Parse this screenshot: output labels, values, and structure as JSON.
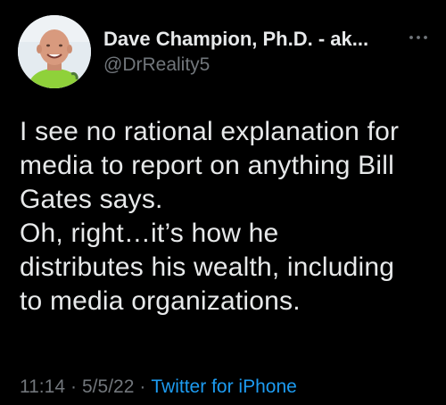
{
  "author": {
    "display_name": "Dave Champion, Ph.D. - ak...",
    "handle": "@DrReality5",
    "avatar_icon": "profile-photo"
  },
  "tweet": {
    "lines": [
      "I see no rational explanation for",
      "media to report on anything Bill",
      "Gates says.",
      "Oh, right…it’s how he",
      "distributes his wealth, including",
      "to media organizations."
    ]
  },
  "meta": {
    "time": "11:14",
    "separator": "·",
    "date": "5/5/22",
    "source": "Twitter for iPhone"
  },
  "colors": {
    "background": "#000000",
    "text": "#e7e9ea",
    "secondary": "#71767b",
    "link": "#1d9bf0"
  },
  "icons": {
    "more": "more-dots-icon"
  }
}
